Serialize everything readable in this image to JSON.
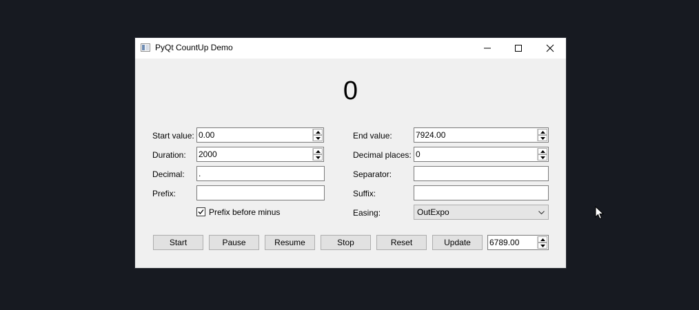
{
  "window": {
    "title": "PyQt CountUp Demo",
    "controls": [
      "minimize-icon",
      "maximize-icon",
      "close-icon"
    ]
  },
  "display": {
    "value": "0"
  },
  "left": {
    "start_label": "Start value:",
    "start_value": "0.00",
    "duration_label": "Duration:",
    "duration_value": "2000",
    "decimal_label": "Decimal:",
    "decimal_value": ".",
    "prefix_label": "Prefix:",
    "prefix_value": "",
    "prefix_before_minus_label": "Prefix before minus",
    "prefix_before_minus_checked": true
  },
  "right": {
    "end_label": "End value:",
    "end_value": "7924.00",
    "decimal_places_label": "Decimal places:",
    "decimal_places_value": "0",
    "separator_label": "Separator:",
    "separator_value": "",
    "suffix_label": "Suffix:",
    "suffix_value": "",
    "easing_label": "Easing:",
    "easing_value": "OutExpo"
  },
  "buttons": {
    "start": "Start",
    "pause": "Pause",
    "resume": "Resume",
    "stop": "Stop",
    "reset": "Reset",
    "update": "Update"
  },
  "update_value": "6789.00"
}
